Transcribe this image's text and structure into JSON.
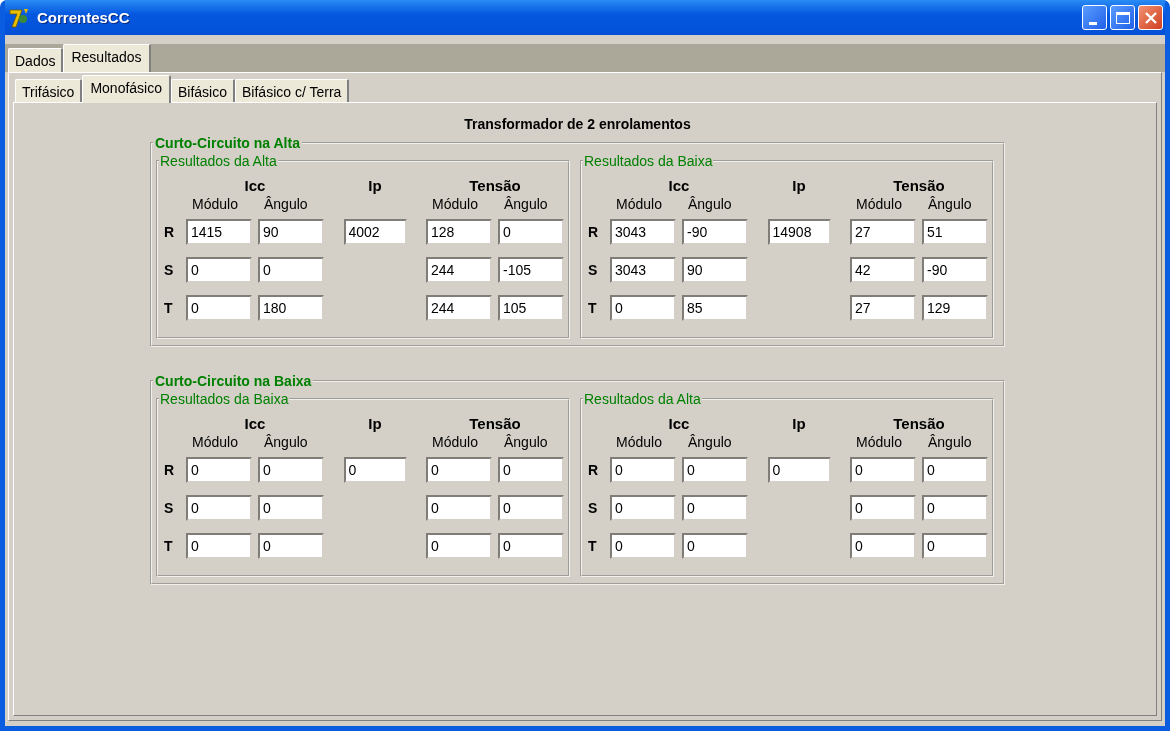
{
  "window": {
    "title": "CorrentesCC"
  },
  "tabs": [
    {
      "label": "Dados",
      "selected": false
    },
    {
      "label": "Resultados",
      "selected": true
    }
  ],
  "subtabs": [
    {
      "label": "Trifásico",
      "selected": false
    },
    {
      "label": "Monofásico",
      "selected": true
    },
    {
      "label": "Bifásico",
      "selected": false
    },
    {
      "label": "Bifásico c/ Terra",
      "selected": false
    }
  ],
  "heading": "Transformador de 2 enrolamentos",
  "groups": [
    {
      "title": "Curto-Circuito na Alta",
      "panels": [
        {
          "title": "Resultados da Alta",
          "icc_label": "Icc",
          "ip_label": "Ip",
          "tensao_label": "Tensão",
          "icc_columns": [
            "Módulo",
            "Ângulo"
          ],
          "tensao_columns": [
            "Módulo",
            "Ângulo"
          ],
          "rows": [
            {
              "phase": "R",
              "icc": [
                "1415",
                "90"
              ],
              "ip": "4002",
              "tensao": [
                "128",
                "0"
              ]
            },
            {
              "phase": "S",
              "icc": [
                "0",
                "0"
              ],
              "tensao": [
                "244",
                "-105"
              ]
            },
            {
              "phase": "T",
              "icc": [
                "0",
                "180"
              ],
              "tensao": [
                "244",
                "105"
              ]
            }
          ]
        },
        {
          "title": "Resultados da Baixa",
          "icc_label": "Icc",
          "ip_label": "Ip",
          "tensao_label": "Tensão",
          "icc_columns": [
            "Módulo",
            "Ângulo"
          ],
          "tensao_columns": [
            "Módulo",
            "Ângulo"
          ],
          "rows": [
            {
              "phase": "R",
              "icc": [
                "3043",
                "-90"
              ],
              "ip": "14908",
              "tensao": [
                "27",
                "51"
              ]
            },
            {
              "phase": "S",
              "icc": [
                "3043",
                "90"
              ],
              "tensao": [
                "42",
                "-90"
              ]
            },
            {
              "phase": "T",
              "icc": [
                "0",
                "85"
              ],
              "tensao": [
                "27",
                "129"
              ]
            }
          ]
        }
      ]
    },
    {
      "title": "Curto-Circuito na Baixa",
      "panels": [
        {
          "title": "Resultados da Baixa",
          "icc_label": "Icc",
          "ip_label": "Ip",
          "tensao_label": "Tensão",
          "icc_columns": [
            "Módulo",
            "Ângulo"
          ],
          "tensao_columns": [
            "Módulo",
            "Ângulo"
          ],
          "rows": [
            {
              "phase": "R",
              "icc": [
                "0",
                "0"
              ],
              "ip": "0",
              "tensao": [
                "0",
                "0"
              ]
            },
            {
              "phase": "S",
              "icc": [
                "0",
                "0"
              ],
              "tensao": [
                "0",
                "0"
              ]
            },
            {
              "phase": "T",
              "icc": [
                "0",
                "0"
              ],
              "tensao": [
                "0",
                "0"
              ]
            }
          ]
        },
        {
          "title": "Resultados da Alta",
          "icc_label": "Icc",
          "ip_label": "Ip",
          "tensao_label": "Tensão",
          "icc_columns": [
            "Módulo",
            "Ângulo"
          ],
          "tensao_columns": [
            "Módulo",
            "Ângulo"
          ],
          "rows": [
            {
              "phase": "R",
              "icc": [
                "0",
                "0"
              ],
              "ip": "0",
              "tensao": [
                "0",
                "0"
              ]
            },
            {
              "phase": "S",
              "icc": [
                "0",
                "0"
              ],
              "tensao": [
                "0",
                "0"
              ]
            },
            {
              "phase": "T",
              "icc": [
                "0",
                "0"
              ],
              "tensao": [
                "0",
                "0"
              ]
            }
          ]
        }
      ]
    }
  ]
}
